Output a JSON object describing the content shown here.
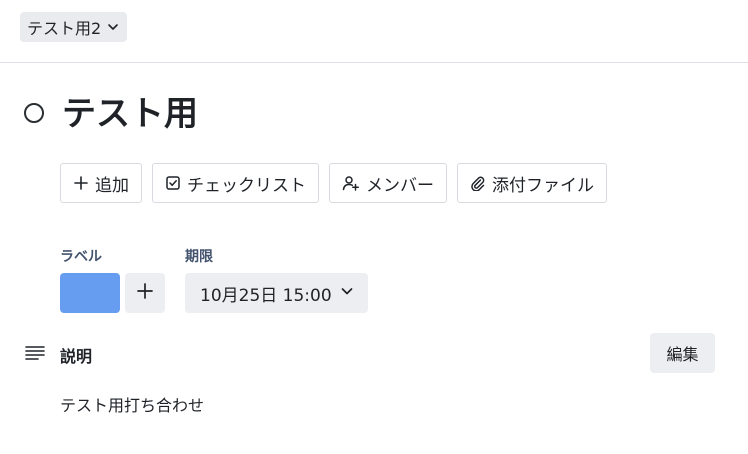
{
  "list_selector": {
    "label": "テスト用2",
    "icon": "chevron-down-icon"
  },
  "card": {
    "title": "テスト用",
    "complete_icon": "circle-icon"
  },
  "actions": [
    {
      "label": "追加",
      "icon": "plus-icon"
    },
    {
      "label": "チェックリスト",
      "icon": "checkbox-icon"
    },
    {
      "label": "メンバー",
      "icon": "add-member-icon"
    },
    {
      "label": "添付ファイル",
      "icon": "paperclip-icon"
    }
  ],
  "labels_section": {
    "title": "ラベル",
    "label_color": "#669df1",
    "add_icon": "plus-icon"
  },
  "due_section": {
    "title": "期限",
    "value": "10月25日 15:00",
    "icon": "chevron-down-icon"
  },
  "description": {
    "heading": "説明",
    "icon": "description-lines-icon",
    "edit_label": "編集",
    "text": "テスト用打ち合わせ"
  },
  "colors": {
    "chip_bg": "#e9ebee",
    "button_bg": "#eceef1",
    "border": "#d7dadf",
    "text": "#1f2328",
    "muted_text": "#44546f",
    "label_blue": "#669df1"
  }
}
